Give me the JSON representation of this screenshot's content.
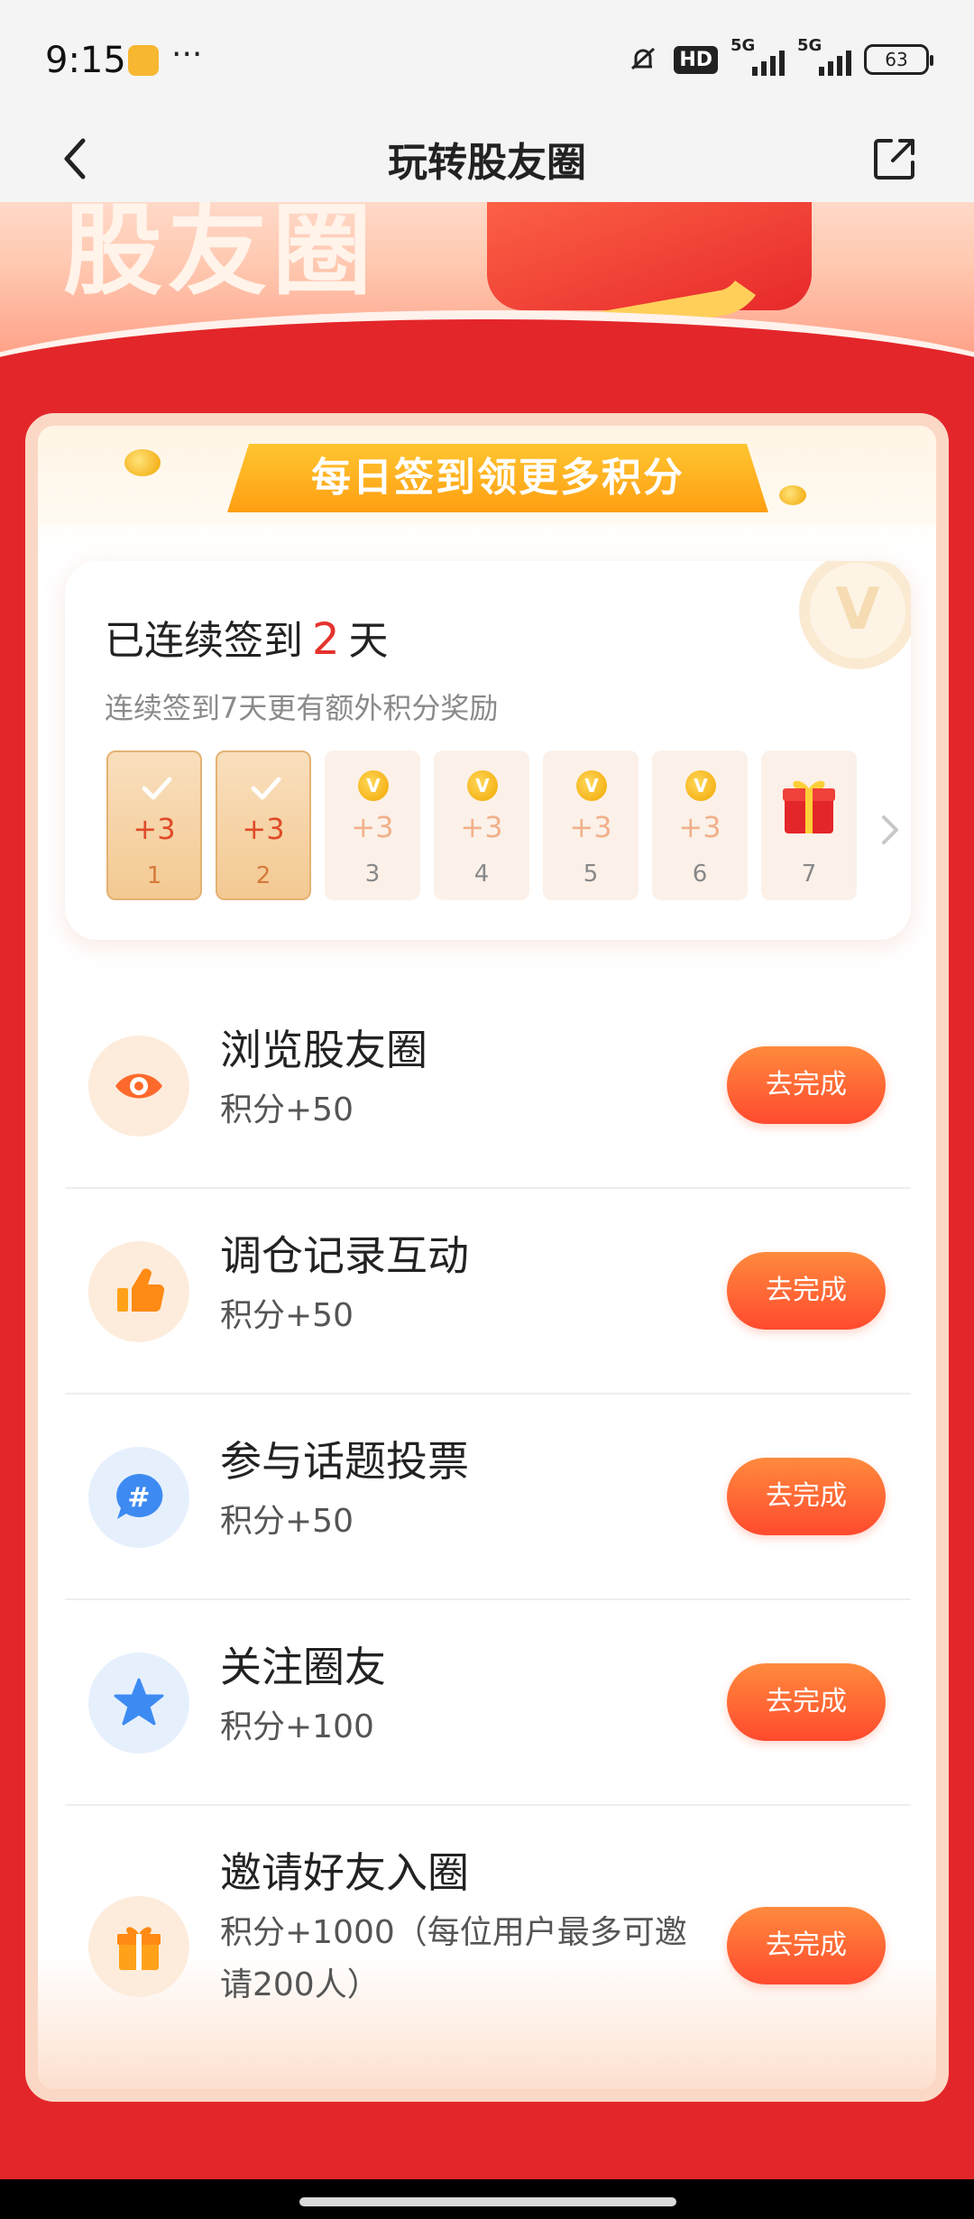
{
  "status_bar": {
    "time": "9:15",
    "dots": "···",
    "hd": "HD",
    "sim1": "5G",
    "sim2": "5G",
    "battery": "63"
  },
  "nav": {
    "title": "玩转股友圈"
  },
  "banner": {
    "text": "股友圈"
  },
  "daily": {
    "ribbon_title": "每日签到领更多积分",
    "checkin_prefix": "已连续签到",
    "checkin_days": "2",
    "checkin_suffix": "天",
    "subtitle": "连续签到7天更有额外积分奖励",
    "deco_letter": "V",
    "days": [
      {
        "num": "1",
        "points": "+3",
        "state": "done"
      },
      {
        "num": "2",
        "points": "+3",
        "state": "done"
      },
      {
        "num": "3",
        "points": "+3",
        "state": "pending"
      },
      {
        "num": "4",
        "points": "+3",
        "state": "pending"
      },
      {
        "num": "5",
        "points": "+3",
        "state": "pending"
      },
      {
        "num": "6",
        "points": "+3",
        "state": "pending"
      },
      {
        "num": "7",
        "points": "",
        "state": "gift"
      }
    ]
  },
  "tasks": [
    {
      "title": "浏览股友圈",
      "reward": "积分+50",
      "button": "去完成",
      "icon": "eye-icon"
    },
    {
      "title": "调仓记录互动",
      "reward": "积分+50",
      "button": "去完成",
      "icon": "thumbs-up-icon"
    },
    {
      "title": "参与话题投票",
      "reward": "积分+50",
      "button": "去完成",
      "icon": "hashtag-chat-icon"
    },
    {
      "title": "关注圈友",
      "reward": "积分+100",
      "button": "去完成",
      "icon": "star-icon"
    },
    {
      "title": "邀请好友入圈",
      "reward": "积分+1000（每位用户最多可邀请200人）",
      "button": "去完成",
      "icon": "gift-icon"
    }
  ],
  "colors": {
    "page_red": "#e3262a",
    "button_orange": "#ff5a30",
    "accent_red": "#e5322d",
    "ribbon_yellow": "#ffb020"
  }
}
